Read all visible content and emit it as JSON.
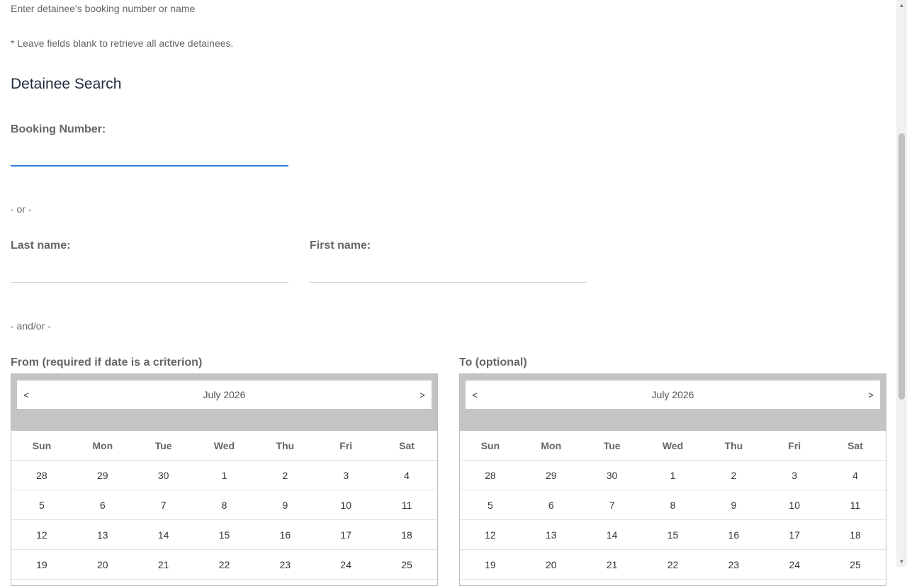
{
  "hints": {
    "enter": "Enter detainee's booking number or name",
    "leave_blank": "* Leave fields blank to retrieve all active detainees."
  },
  "title": "Detainee Search",
  "booking": {
    "label": "Booking Number:",
    "value": ""
  },
  "or_text": "- or -",
  "last_name": {
    "label": "Last name:",
    "value": ""
  },
  "first_name": {
    "label": "First name:",
    "value": ""
  },
  "andor_text": "- and/or -",
  "from_cal": {
    "label": "From (required if date is a criterion)",
    "month": "July 2026",
    "prev": "<",
    "next": ">",
    "days_of_week": [
      "Sun",
      "Mon",
      "Tue",
      "Wed",
      "Thu",
      "Fri",
      "Sat"
    ],
    "weeks": [
      [
        "28",
        "29",
        "30",
        "1",
        "2",
        "3",
        "4"
      ],
      [
        "5",
        "6",
        "7",
        "8",
        "9",
        "10",
        "11"
      ],
      [
        "12",
        "13",
        "14",
        "15",
        "16",
        "17",
        "18"
      ],
      [
        "19",
        "20",
        "21",
        "22",
        "23",
        "24",
        "25"
      ]
    ]
  },
  "to_cal": {
    "label": "To (optional)",
    "month": "July 2026",
    "prev": "<",
    "next": ">",
    "days_of_week": [
      "Sun",
      "Mon",
      "Tue",
      "Wed",
      "Thu",
      "Fri",
      "Sat"
    ],
    "weeks": [
      [
        "28",
        "29",
        "30",
        "1",
        "2",
        "3",
        "4"
      ],
      [
        "5",
        "6",
        "7",
        "8",
        "9",
        "10",
        "11"
      ],
      [
        "12",
        "13",
        "14",
        "15",
        "16",
        "17",
        "18"
      ],
      [
        "19",
        "20",
        "21",
        "22",
        "23",
        "24",
        "25"
      ]
    ]
  },
  "colors": {
    "focus_underline": "#2a7fd6",
    "calendar_header": "#c4c4c4",
    "title": "#1f2a3d"
  },
  "icons": {
    "scroll_up": "scroll-up-arrow-icon",
    "scroll_down": "scroll-down-arrow-icon"
  }
}
